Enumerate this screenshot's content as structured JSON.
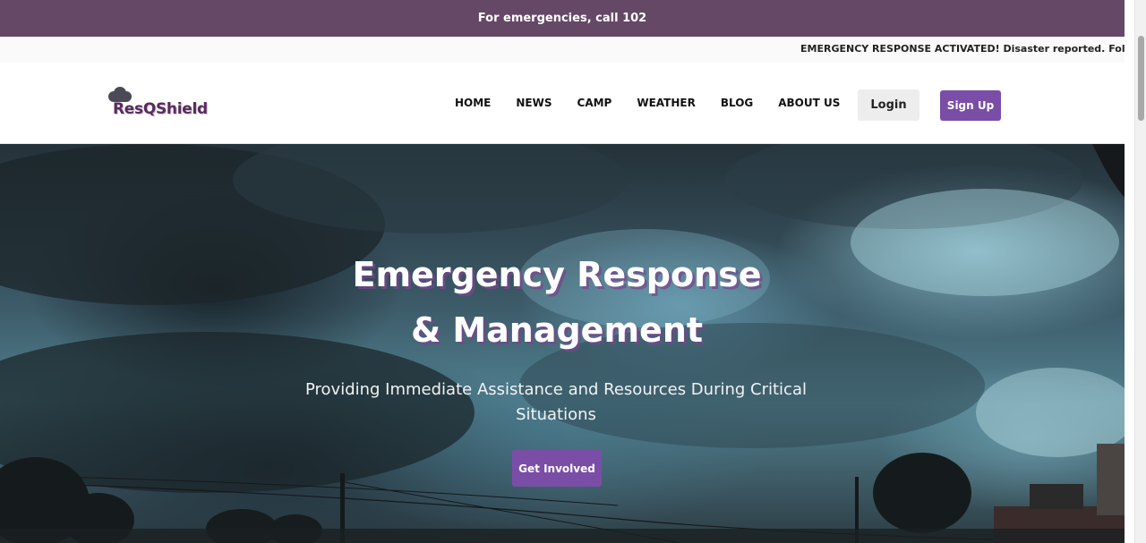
{
  "topbar": {
    "text": "For emergencies, call 102"
  },
  "ticker": {
    "text": "EMERGENCY RESPONSE ACTIVATED! Disaster reported. Follow instr"
  },
  "brand": {
    "name": "ResQShield",
    "icon": "cloud-icon"
  },
  "nav": {
    "items": [
      {
        "label": "HOME"
      },
      {
        "label": "NEWS"
      },
      {
        "label": "CAMP"
      },
      {
        "label": "WEATHER"
      },
      {
        "label": "BLOG"
      },
      {
        "label": "ABOUT US"
      }
    ],
    "login_label": "Login",
    "signup_label": "Sign Up"
  },
  "hero": {
    "title_line1": "Emergency Response",
    "title_line2": "& Management",
    "subtitle": "Providing Immediate Assistance and Resources During Critical Situations",
    "cta_label": "Get Involved"
  },
  "colors": {
    "brand_purple": "#654866",
    "accent_purple": "#7a4ea6",
    "logo_text": "#5a2a5e"
  }
}
